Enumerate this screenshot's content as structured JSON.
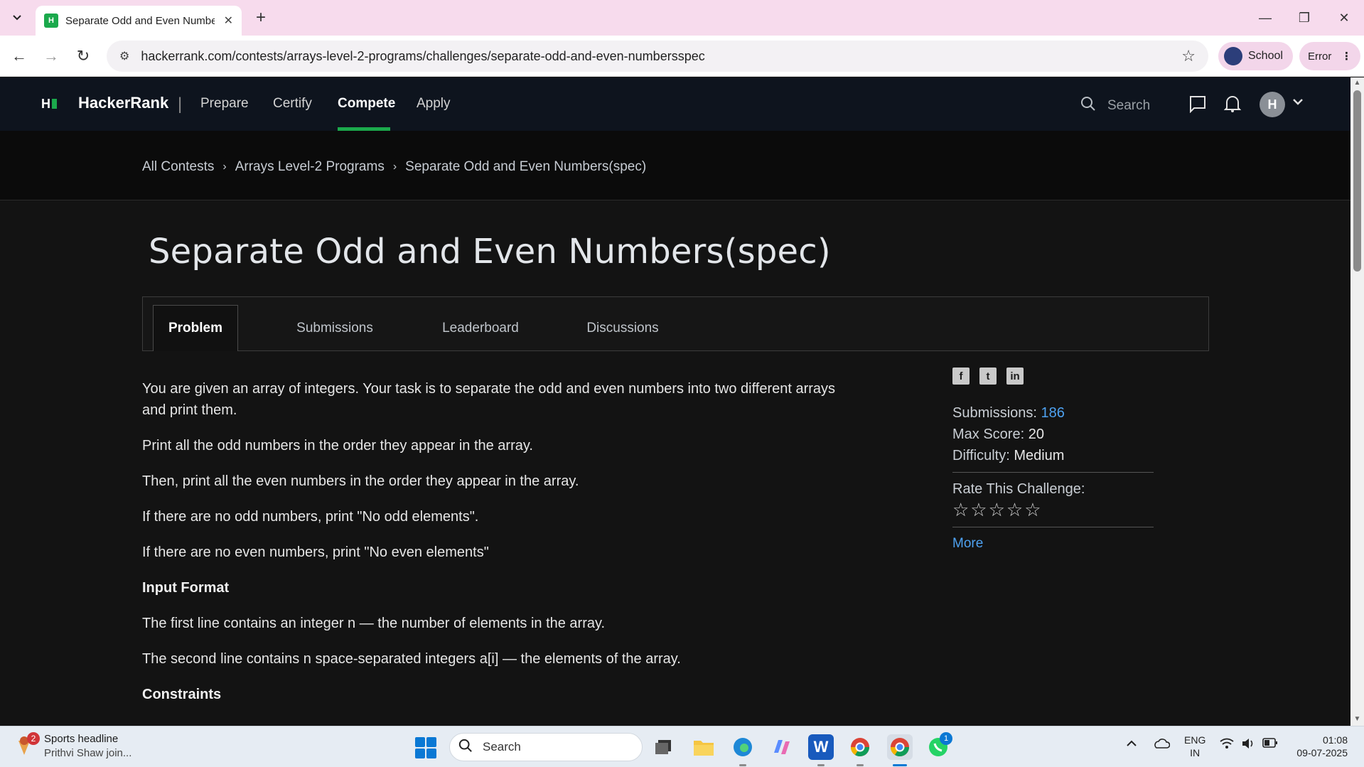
{
  "browser": {
    "tab_title": "Separate Odd and Even Numbe",
    "url": "hackerrank.com/contests/arrays-level-2-programs/challenges/separate-odd-and-even-numbersspec",
    "profile_label": "School",
    "error_label": "Error"
  },
  "hr_nav": {
    "logo_mark": "H",
    "brand": "HackerRank",
    "links": [
      "Prepare",
      "Certify",
      "Compete",
      "Apply"
    ],
    "active_link": "Compete",
    "search_placeholder": "Search",
    "avatar_letter": "H"
  },
  "breadcrumb": [
    "All Contests",
    "Arrays Level-2 Programs",
    "Separate Odd and Even Numbers(spec)"
  ],
  "challenge": {
    "title": "Separate Odd and Even Numbers(spec)",
    "tabs": [
      "Problem",
      "Submissions",
      "Leaderboard",
      "Discussions"
    ],
    "active_tab": "Problem",
    "paragraphs": [
      "You are given an array of integers. Your task is to separate the odd and even numbers into two different arrays and print them.",
      "Print all the odd numbers in the order they appear in the array.",
      "Then, print all the even numbers in the order they appear in the array.",
      "If there are no odd numbers, print \"No odd elements\".",
      "If there are no even numbers, print \"No even elements\""
    ],
    "input_format_heading": "Input Format",
    "input_format": [
      "The first line contains an integer n — the number of elements in the array.",
      "The second line contains n space-separated integers a[i] — the elements of the array."
    ],
    "constraints_heading": "Constraints"
  },
  "sidebar": {
    "submissions_label": "Submissions:",
    "submissions_value": "186",
    "max_score_label": "Max Score:",
    "max_score_value": "20",
    "difficulty_label": "Difficulty:",
    "difficulty_value": "Medium",
    "rate_label": "Rate This Challenge:",
    "stars": "☆☆☆☆☆",
    "more_link": "More"
  },
  "taskbar": {
    "news_badge": "2",
    "news_title": "Sports headline",
    "news_sub": "Prithvi Shaw join...",
    "search_placeholder": "Search",
    "whatsapp_badge": "1",
    "lang_top": "ENG",
    "lang_bottom": "IN",
    "time": "01:08",
    "date": "09-07-2025"
  },
  "colors": {
    "accent_green": "#1ba94c",
    "link_blue": "#4ea2f1",
    "nav_bg": "#0e141e"
  }
}
